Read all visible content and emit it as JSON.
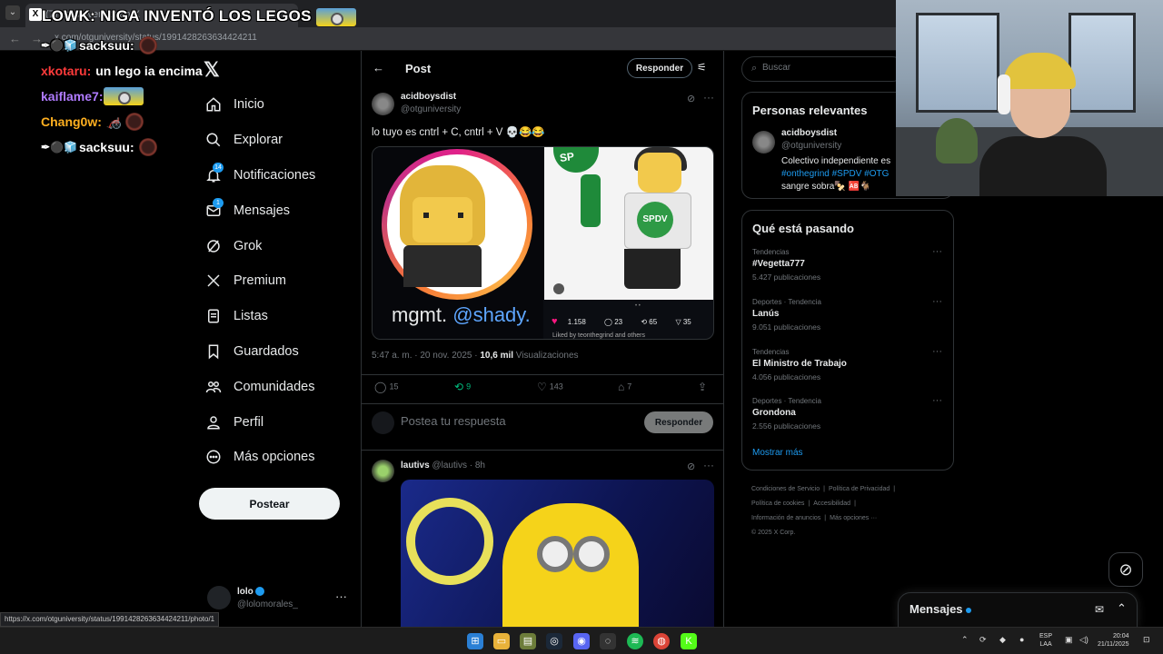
{
  "browser": {
    "tab_title": "(7) otguniversity en X",
    "url": "x.com/otguniversity/status/1991428263634424211",
    "status_url": "https://x.com/otguniversity/status/1991428263634424211/photo/1"
  },
  "overlay": {
    "title": "LOWK: NIGA INVENTÓ LOS LEGOS",
    "chat": [
      {
        "user": "sacksuu:",
        "message": "",
        "color": "#ffffff"
      },
      {
        "user": "xkotaru:",
        "message": "un lego ia encima",
        "color": "#ff3b3b"
      },
      {
        "user": "kaiflame7:",
        "message": "",
        "color": "#b07bff"
      },
      {
        "user": "Chang0w:",
        "message": "",
        "color": "#ffb020"
      },
      {
        "user": "sacksuu:",
        "message": "",
        "color": "#ffffff"
      }
    ]
  },
  "sidebar": {
    "items": [
      {
        "label": "Inicio",
        "icon": "home-icon"
      },
      {
        "label": "Explorar",
        "icon": "search-icon"
      },
      {
        "label": "Notificaciones",
        "icon": "bell-icon",
        "badge": "14"
      },
      {
        "label": "Mensajes",
        "icon": "mail-icon",
        "badge": "1"
      },
      {
        "label": "Grok",
        "icon": "grok-icon"
      },
      {
        "label": "Premium",
        "icon": "x-logo-icon"
      },
      {
        "label": "Listas",
        "icon": "list-icon"
      },
      {
        "label": "Guardados",
        "icon": "bookmark-icon"
      },
      {
        "label": "Comunidades",
        "icon": "communities-icon"
      },
      {
        "label": "Perfil",
        "icon": "person-icon"
      },
      {
        "label": "Más opciones",
        "icon": "more-circle-icon"
      }
    ],
    "post_button": "Postear",
    "account": {
      "name": "lolo",
      "handle": "@lolomorales_"
    }
  },
  "post": {
    "header_title": "Post",
    "reply_button": "Responder",
    "author_name": "acidboysdist",
    "author_handle": "@otguniversity",
    "text": "lo tuyo es cntrl + C, cntrl + V 💀😂😂",
    "media": {
      "caption_prefix": "mgmt.",
      "caption_handle": "@shady.",
      "right_logo": "SPDV",
      "stats": {
        "likes": "1.158",
        "comments": "23",
        "reposts": "65",
        "shares": "35"
      },
      "liked_by": "Liked by teonthegrind and others"
    },
    "timestamp": "5:47 a. m. · 20 nov. 2025 · ",
    "views_count": "10,6 mil",
    "views_label": " Visualizaciones",
    "actions": {
      "replies": "15",
      "reposts": "9",
      "likes": "143",
      "bookmarks": "7"
    },
    "reply_placeholder": "Postea tu respuesta",
    "reply_submit": "Responder"
  },
  "second_post": {
    "name": "lautivs",
    "meta": "@lautivs · 8h"
  },
  "right": {
    "search_placeholder": "Buscar",
    "relevant_title": "Personas relevantes",
    "relevant": {
      "name": "acidboysdist",
      "handle": "@otguniversity",
      "bio_text": "Colectivo independiente es",
      "bio_tags": "#onthegrind #SPDV #OTG",
      "bio_tail": "sangre sobra🍢 🆎🐐"
    },
    "trends_title": "Qué está pasando",
    "trends": [
      {
        "category": "Tendencias",
        "name": "#Vegetta777",
        "count": "5.427 publicaciones"
      },
      {
        "category": "Deportes · Tendencia",
        "name": "Lanús",
        "count": "9.051 publicaciones"
      },
      {
        "category": "Tendencias",
        "name": "El Ministro de Trabajo",
        "count": "4.056 publicaciones"
      },
      {
        "category": "Deportes · Tendencia",
        "name": "Grondona",
        "count": "2.556 publicaciones"
      }
    ],
    "show_more": "Mostrar más",
    "footer": [
      "Condiciones de Servicio",
      "|",
      "Política de Privacidad",
      "|",
      "Política de cookies",
      "|",
      "Accesibilidad",
      "|",
      "Información de anuncios",
      "|",
      "Más opciones ···",
      "© 2025 X Corp."
    ]
  },
  "messages_drawer": {
    "title": "Mensajes"
  },
  "taskbar": {
    "lang_top": "ESP",
    "lang_bottom": "LAA",
    "time": "20:04",
    "date": "21/11/2025"
  },
  "colors": {
    "accent": "#1d9bf0",
    "background": "#000000",
    "text": "#e7e9ea",
    "muted": "#71767b",
    "repost_green": "#00ba7c",
    "like_pink": "#f91880"
  }
}
